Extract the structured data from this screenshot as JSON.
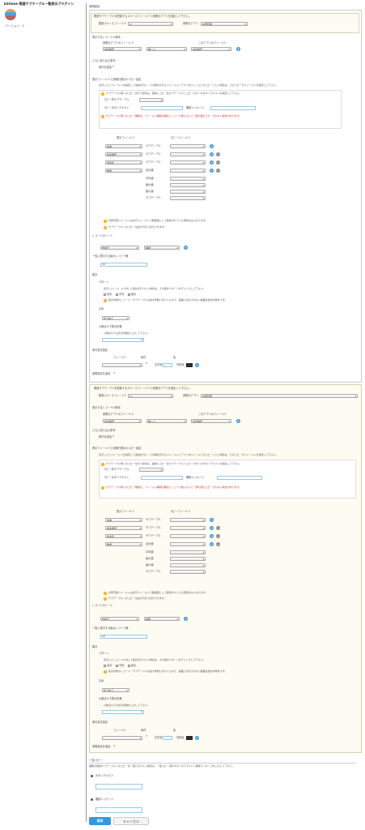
{
  "sidebar": {
    "title": "kintone 関連サブテーブル一覧表示プラグイン",
    "version": "バージョン：5"
  },
  "main": {
    "section_label": "参照設定",
    "bottom_label": "一括コピー"
  },
  "s1": {
    "intro": "関連サブテーブルを配置するスペースフィールドと参照元アプリを指定して下さい。",
    "space_label": "配置スペースフィールド",
    "space_value": "nl",
    "app_label": "参照元アプリ",
    "app_value": "在庫管理",
    "cond_label": "表示するレコードの条件",
    "ref_field_label": "参照元アプリのフィールド",
    "this_field_label": "このアプリのフィールド",
    "cond_field": "商品番号",
    "cond_op": "等しい",
    "cond_this": "商品番号",
    "more_label": "さらに絞り込む条件",
    "add_cond": "条件を追加",
    "copy_label": "表示フィールドと詳細行表示のコピー設定",
    "copy_hint": "表示したいフィールドを指定して追加を行い、その時表示するフィールドとアプリ内フィールドがコピーしたい場合は、そのコピー元フィールドを指定して下さい。",
    "copy_note1": "サブテーブル側へのコピーを行う場合は、事前にコピー先サブテーブルとコピーボタンのボタンテキストを指定して下さい。",
    "copy_to_label": "コピー先サブテーブル",
    "btn_text_label": "コピーボタンテキスト",
    "confirm_label": "確認メッセージ",
    "copy_note2": "サブテーブル側へのコピー機能は、フィールド種類の都合とレコード数によって一部の値がコピーされない場合があります。",
    "disp_field_label": "表示フィールド",
    "copy_field_label": "コピーフィールド",
    "rows": [
      {
        "field": "品番",
        "kind": "サブテーブル",
        "minus": false
      },
      {
        "field": "商品番号",
        "kind": "サブテーブル",
        "minus": true
      },
      {
        "field": "商品名",
        "kind": "サブテーブル",
        "minus": true
      },
      {
        "field": "数量",
        "kind": "合計値",
        "minus": true
      }
    ],
    "aggs": [
      "平均値",
      "最大値",
      "最小値",
      "サブテーブル"
    ],
    "note3": "計算可能フィールドは表示フィールドで数値型として使用されている項目のみになります。",
    "note4": "サブテーブルへのコピーは最大行まで表示できます。",
    "sort_label": "レコードのソート",
    "sort_field": "作成日",
    "sort_order": "降順",
    "perpage_label": "一覧に表示する最大レコード数",
    "perpage_value": "10",
    "agg_label": "集計",
    "pattern_label": "パターン",
    "pattern_hint": "表示したレコードに対して集計を行いたい場合は、その集計パターンをチェックして下さい。",
    "check_sum": "合計",
    "check_avg": "平均",
    "check_max": "最大",
    "pattern_note": "集計対象のレコード・サブテーブルは最大件数に基づくもので、画面に表示されない範囲は集計対象外です。",
    "round_label": "丸め",
    "round_value": "切り捨て",
    "digits_label": "小数点以下表示桁数",
    "digits_hint": "小数点以下の表示桁数を入力して下さい。",
    "digits_value": "0",
    "style_label": "条件書式設定",
    "field_col": "フィールド",
    "cond_col": "条件",
    "color_col": "色",
    "text_color": "文字色",
    "bg_color": "背景色",
    "add_block": "参照設定を追加"
  },
  "bulk": {
    "intro": "複数の関連サブテーブルへのコピーを一度に行いたい場合は、一括コピー用のボタンのテキストと確認メッセージを入力して下さい。",
    "button_label": "ボタンテキスト",
    "confirm_label": "確認メッセージ"
  },
  "footer": {
    "save": "保存",
    "cancel": "キャンセル"
  }
}
